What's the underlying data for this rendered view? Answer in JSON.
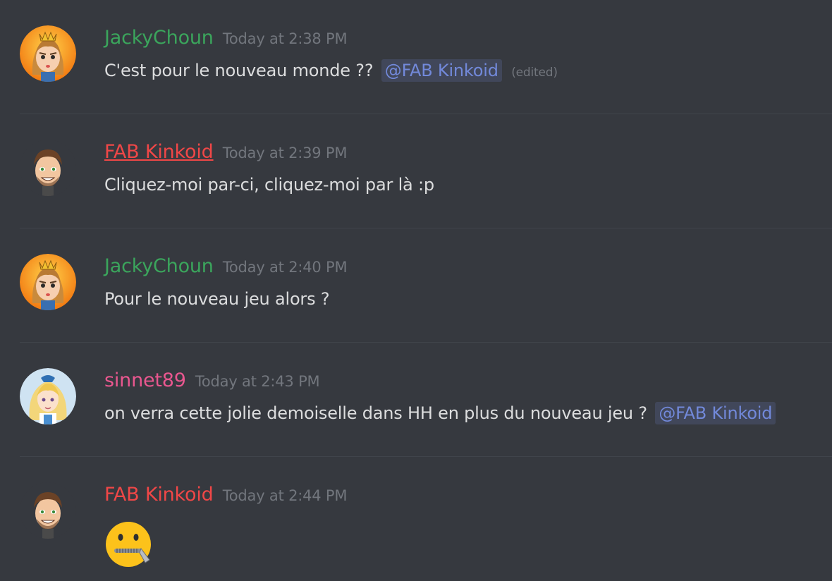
{
  "colors": {
    "background": "#36393f",
    "jacky": "#3ba55c",
    "fab": "#f04747",
    "sinnet": "#e9578f",
    "mention": "#7289da",
    "timestamp": "#72767d",
    "text": "#dcddde"
  },
  "messages": [
    {
      "username": "JackyChoun",
      "timestamp": "Today at 2:38 PM",
      "text": "C'est pour le nouveau monde ??",
      "mention": "@FAB Kinkoid",
      "edited": "(edited)"
    },
    {
      "username": "FAB Kinkoid",
      "timestamp": "Today at 2:39 PM",
      "text": "Cliquez-moi par-ci, cliquez-moi par là :p"
    },
    {
      "username": "JackyChoun",
      "timestamp": "Today at 2:40 PM",
      "text": "Pour le nouveau jeu alors ?"
    },
    {
      "username": "sinnet89",
      "timestamp": "Today at 2:43 PM",
      "text": "on verra cette jolie demoiselle dans HH en plus du nouveau jeu ?",
      "mention": "@FAB Kinkoid"
    },
    {
      "username": "FAB Kinkoid",
      "timestamp": "Today at 2:44 PM",
      "emoji": "zipper-mouth-face-icon"
    }
  ]
}
